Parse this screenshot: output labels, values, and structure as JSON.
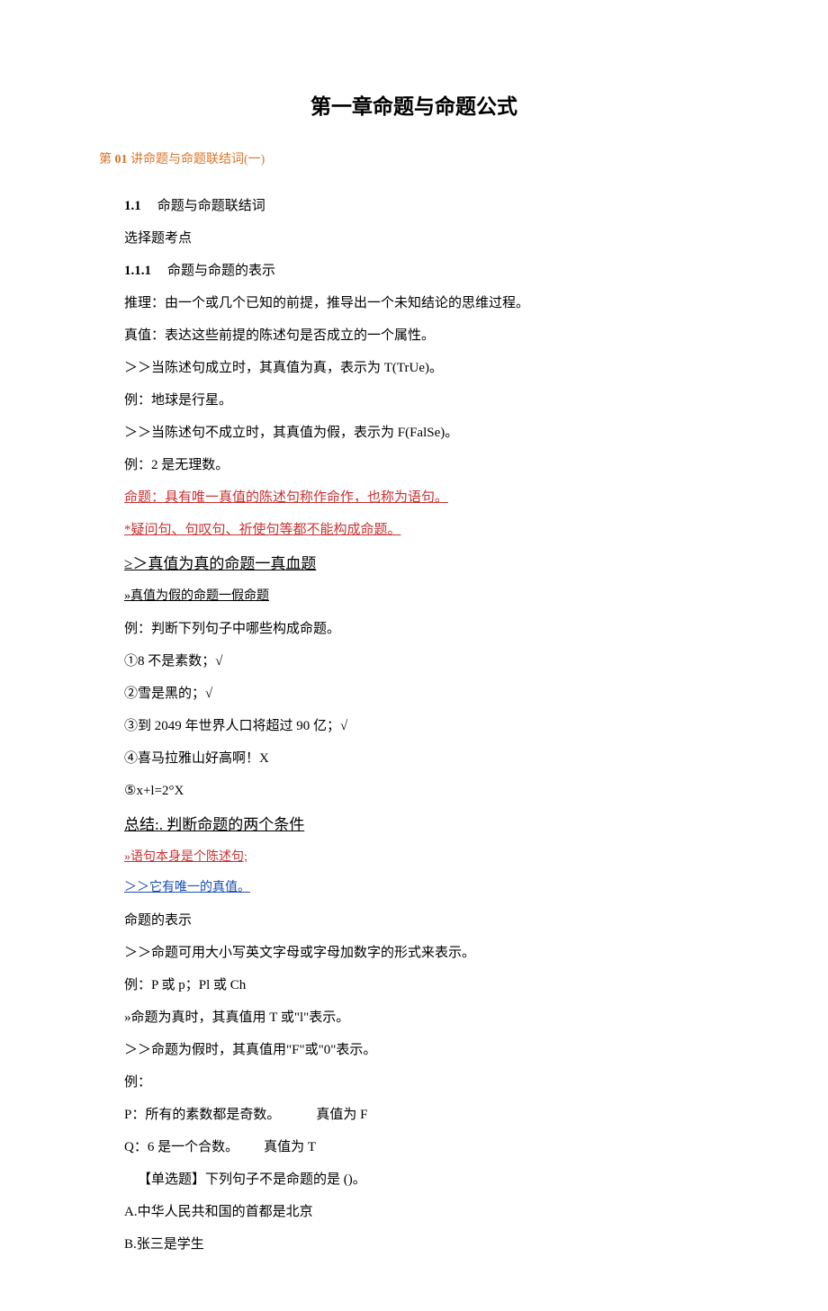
{
  "title": "第一章命题与命题公式",
  "lecture": {
    "prefix": "第 ",
    "num": "01",
    "suffix": " 讲命题与命题联结词(一)"
  },
  "s1": {
    "num": "1.1",
    "text": "命题与命题联结词"
  },
  "s2": "选择题考点",
  "s3": {
    "num": "1.1.1",
    "text": "命题与命题的表示"
  },
  "p4": "推理：由一个或几个已知的前提，推导出一个未知结论的思维过程。",
  "p5": "真值：表达这些前提的陈述句是否成立的一个属性。",
  "p6": "＞＞当陈述句成立时，其真值为真，表示为 T(TrUe)。",
  "p7": "例：地球是行星。",
  "p8": "＞＞当陈述句不成立时，其真值为假，表示为 F(FalSe)。",
  "p9": "例：2 是无理数。",
  "p10": "命题：具有唯一真值的陈述句称作命作，也称为语句。 ",
  "p11": "*疑问句、句叹句、祈使句等都不能构成命题。 ",
  "p12": "≥＞真值为真的命题一真血题",
  "p13": "»真值为假的命题一假命题",
  "p14": "例：判断下列句子中哪些构成命题。",
  "p15": "①8 不是素数；√",
  "p16": "②雪是黑的；√",
  "p17": "③到 2049 年世界人口将超过 90 亿；√",
  "p18": "④喜马拉雅山好高啊！X",
  "p19": "⑤x+l=2°X",
  "p20": "总结:. 判断命题的两个条件",
  "p21": "»语句本身是个陈述句; ",
  "p22": "＞＞它有唯一的真值。 ",
  "p23": "命题的表示",
  "p24": "＞＞命题可用大小写英文字母或字母加数字的形式来表示。",
  "p25": "例：P 或 p；Pl 或 Ch",
  "p26": "»命题为真时，其真值用 T 或\"l\"表示。",
  "p27": "＞＞命题为假时，其真值用\"F\"或\"0\"表示。",
  "p28": "例：",
  "p29a": "P：所有的素数都是奇数。",
  "p29b": "真值为 F",
  "p30a": "Q：6 是一个合数。",
  "p30b": "真值为 T",
  "p31": "【单选题】下列句子不是命题的是 ()。",
  "p32": "A.中华人民共和国的首都是北京",
  "p33": "B.张三是学生"
}
